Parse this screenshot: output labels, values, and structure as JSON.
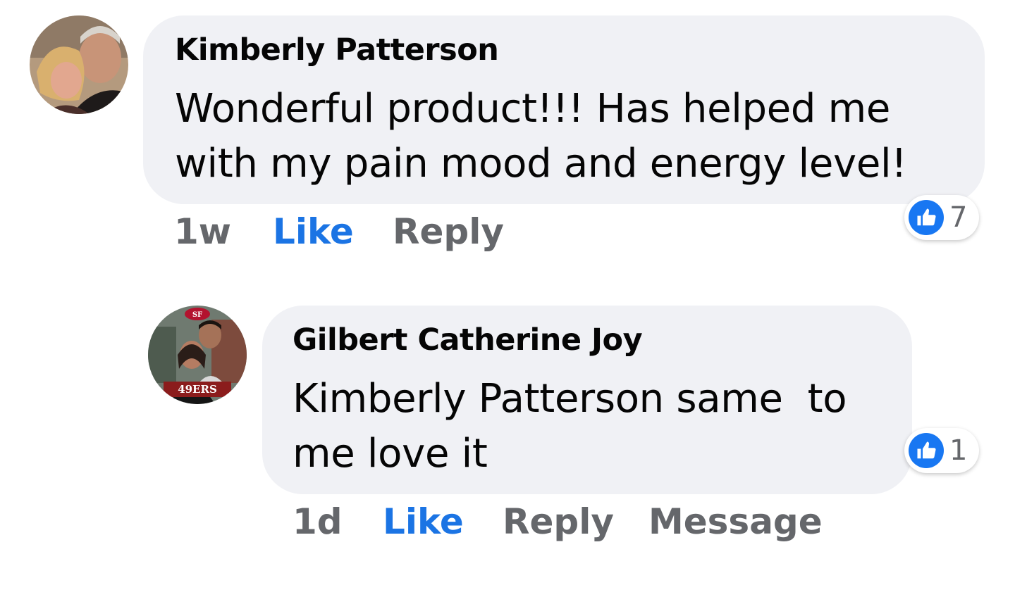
{
  "comments": [
    {
      "author": "Kimberly Patterson",
      "text": "Wonderful product!!! Has helped me\nwith my pain mood and energy level!",
      "timestamp": "1w",
      "like_label": "Like",
      "reply_label": "Reply",
      "reaction_icon": "thumbs-up-icon",
      "reaction_count": "7"
    },
    {
      "author": "Gilbert Catherine Joy",
      "text": "Kimberly Patterson same  to\nme love it",
      "timestamp": "1d",
      "like_label": "Like",
      "reply_label": "Reply",
      "message_label": "Message",
      "reaction_icon": "thumbs-up-icon",
      "reaction_count": "1"
    }
  ],
  "colors": {
    "bubble_bg": "#f0f1f5",
    "like_blue": "#1b74e4",
    "reaction_blue": "#1877f2",
    "meta_gray": "#65676b"
  }
}
